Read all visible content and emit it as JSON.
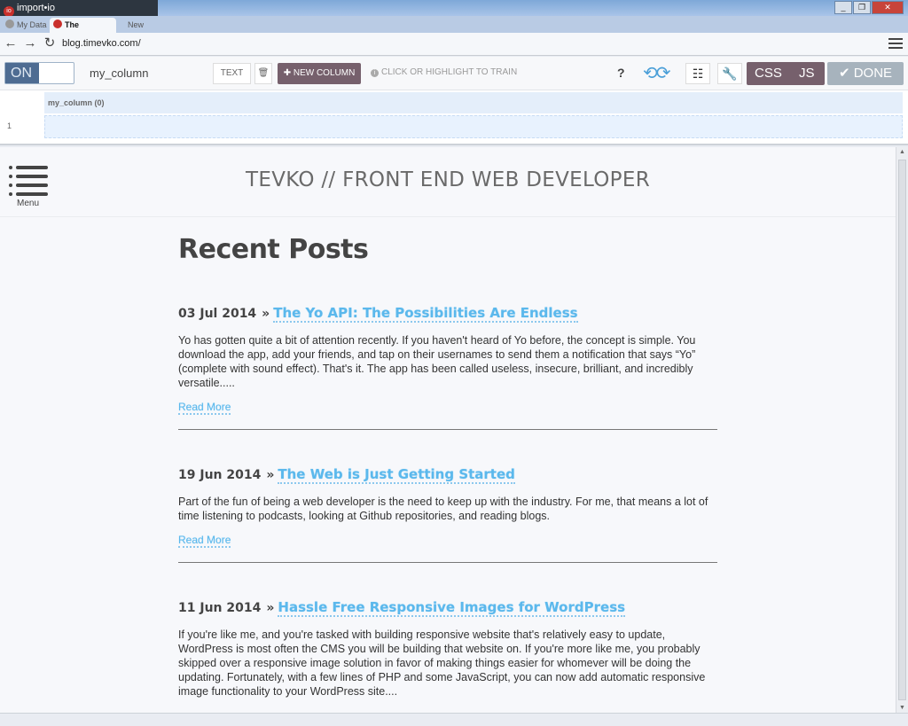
{
  "window": {
    "app_title": "import•io",
    "controls": [
      "_",
      "❐",
      "✕"
    ]
  },
  "tabs": [
    {
      "label": "My Data",
      "active": false
    },
    {
      "label": "The Blog",
      "active": true
    },
    {
      "label": "New",
      "active": false
    }
  ],
  "address_bar": {
    "url": "blog.timevko.com/"
  },
  "toolbar": {
    "toggle_label": "ON",
    "column_name": "my_column",
    "text_button": "TEXT",
    "trash_icon": "🗑",
    "new_column_button": "✚ NEW COLUMN",
    "hint_text": "CLICK OR HIGHLIGHT TO TRAIN",
    "help_label": "?",
    "css_label": "CSS",
    "js_label": "JS",
    "done_label": "✔ DONE"
  },
  "data_table": {
    "column_header": "my_column (0)",
    "row_number": "1"
  },
  "site": {
    "menu_label": "Menu",
    "title": "TEVKO // FRONT END WEB DEVELOPER",
    "section_heading": "Recent Posts",
    "posts": [
      {
        "date": "03 Jul 2014",
        "separator": "»",
        "title": "The Yo API: The Possibilities Are Endless",
        "excerpt": "Yo has gotten quite a bit of attention recently. If you haven't heard of Yo before, the concept is simple. You download the app, add your friends, and tap on their usernames to send them a notification that says “Yo” (complete with sound effect). That's it. The app has been called useless, insecure, brilliant, and incredibly versatile.....",
        "read_more": "Read More"
      },
      {
        "date": "19 Jun 2014",
        "separator": "»",
        "title": "The Web is Just Getting Started",
        "excerpt": "Part of the fun of being a web developer is the need to keep up with the industry. For me, that means a lot of time listening to podcasts, looking at Github repositories, and reading blogs.",
        "read_more": "Read More"
      },
      {
        "date": "11 Jun 2014",
        "separator": "»",
        "title": "Hassle Free Responsive Images for WordPress",
        "excerpt": "If you're like me, and you're tasked with building responsive website that's relatively easy to update, WordPress is most often the CMS you will be building that website on. If you're more like me, you probably skipped over a responsive image solution in favor of making things easier for whomever will be doing the updating. Fortunately, with a few lines of PHP and some JavaScript, you can now add automatic responsive image functionality to your WordPress site....",
        "read_more": ""
      }
    ]
  },
  "colors": {
    "accent_link": "#5bb8ec",
    "button_mauve": "#76606c",
    "done_gray": "#a7b3bd",
    "toggle_blue": "#4e6c92"
  }
}
